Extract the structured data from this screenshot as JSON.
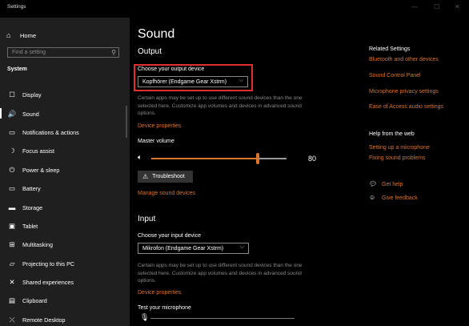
{
  "window": {
    "title": "Settings",
    "minimize": "—",
    "maximize": "☐",
    "close": "✕"
  },
  "sidebar": {
    "home": {
      "label": "Home",
      "icon": "home-icon"
    },
    "search_placeholder": "Find a setting",
    "category": "System",
    "items": [
      {
        "label": "Display",
        "icon": "display-icon",
        "glyph": "☐"
      },
      {
        "label": "Sound",
        "icon": "speaker-icon",
        "glyph": "🔊",
        "active": true
      },
      {
        "label": "Notifications & actions",
        "icon": "notifications-icon",
        "glyph": "▭"
      },
      {
        "label": "Focus assist",
        "icon": "moon-icon",
        "glyph": "☽"
      },
      {
        "label": "Power & sleep",
        "icon": "power-icon",
        "glyph": "⏻"
      },
      {
        "label": "Battery",
        "icon": "battery-icon",
        "glyph": "▭"
      },
      {
        "label": "Storage",
        "icon": "storage-icon",
        "glyph": "▬"
      },
      {
        "label": "Tablet",
        "icon": "tablet-icon",
        "glyph": "▣"
      },
      {
        "label": "Multitasking",
        "icon": "multitasking-icon",
        "glyph": "⊞"
      },
      {
        "label": "Projecting to this PC",
        "icon": "projector-icon",
        "glyph": "▱"
      },
      {
        "label": "Shared experiences",
        "icon": "shared-experiences-icon",
        "glyph": "✕"
      },
      {
        "label": "Clipboard",
        "icon": "clipboard-icon",
        "glyph": "▤"
      },
      {
        "label": "Remote Desktop",
        "icon": "remote-desktop-icon",
        "glyph": "⤫"
      }
    ]
  },
  "main": {
    "title": "Sound",
    "output": {
      "heading": "Output",
      "device_label": "Choose your output device",
      "device_value": "Kopfhörer (Endgame Gear Xstrm)",
      "info": "Certain apps may be set up to use different sound devices than the one selected here. Customize app volumes and devices in advanced sound options.",
      "device_properties": "Device properties",
      "volume_label": "Master volume",
      "volume_value": "80",
      "volume_fraction": 0.8,
      "troubleshoot": "Troubleshoot",
      "manage": "Manage sound devices"
    },
    "input": {
      "heading": "Input",
      "device_label": "Choose your input device",
      "device_value": "Mikrofon (Endgame Gear Xstrm)",
      "info": "Certain apps may be set up to use different sound devices than the one selected here. Customize app volumes and devices in advanced sound options.",
      "device_properties": "Device properties",
      "test_label": "Test your microphone"
    }
  },
  "related": {
    "heading": "Related Settings",
    "links": [
      "Bluetooth and other devices",
      "Sound Control Panel",
      "Microphone privacy settings",
      "Ease of Access audio settings"
    ],
    "help_heading": "Help from the web",
    "help_links": [
      "Setting up a microphone",
      "Fixing sound problems"
    ],
    "get_help": "Get help",
    "feedback": "Give feedback"
  },
  "colors": {
    "accent": "#d9742d",
    "highlight": "#e0302b",
    "sidebar_bg": "#1f1f1f",
    "main_bg": "#000000"
  }
}
